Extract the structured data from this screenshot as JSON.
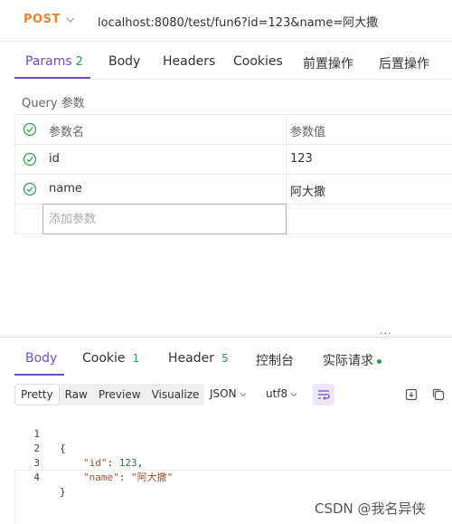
{
  "request": {
    "method": "POST",
    "url": "localhost:8080/test/fun6?id=123&name=阿大撒"
  },
  "request_tabs": [
    {
      "label": "Params",
      "count": "2"
    },
    {
      "label": "Body"
    },
    {
      "label": "Headers"
    },
    {
      "label": "Cookies"
    },
    {
      "label": "前置操作"
    },
    {
      "label": "后置操作"
    }
  ],
  "query_section": {
    "title": "Query 参数",
    "header": {
      "name": "参数名",
      "value": "参数值"
    },
    "rows": [
      {
        "name": "id",
        "value": "123"
      },
      {
        "name": "name",
        "value": "阿大撒"
      }
    ],
    "add_placeholder": "添加参数"
  },
  "splitter_handle": "···",
  "response_tabs": [
    {
      "label": "Body"
    },
    {
      "label": "Cookie",
      "count": "1"
    },
    {
      "label": "Header",
      "count": "5"
    },
    {
      "label": "控制台"
    },
    {
      "label": "实际请求"
    }
  ],
  "toolbar": {
    "formats": [
      "Pretty",
      "Raw",
      "Preview",
      "Visualize"
    ],
    "active_format": "Pretty",
    "format_select": "JSON",
    "encoding_select": "utf8"
  },
  "code": {
    "line_numbers": [
      "1",
      "2",
      "3",
      "4"
    ],
    "open_brace": "{",
    "close_brace": "}",
    "id_key": "\"id\"",
    "id_value": "123",
    "name_key": "\"name\"",
    "name_value": "\"阿大撒\""
  },
  "watermark": "CSDN @我名异侠",
  "colors": {
    "accent": "#6a4fc0",
    "method": "#f0812b",
    "count": "#2e9c52",
    "check": "#2e9c52"
  }
}
